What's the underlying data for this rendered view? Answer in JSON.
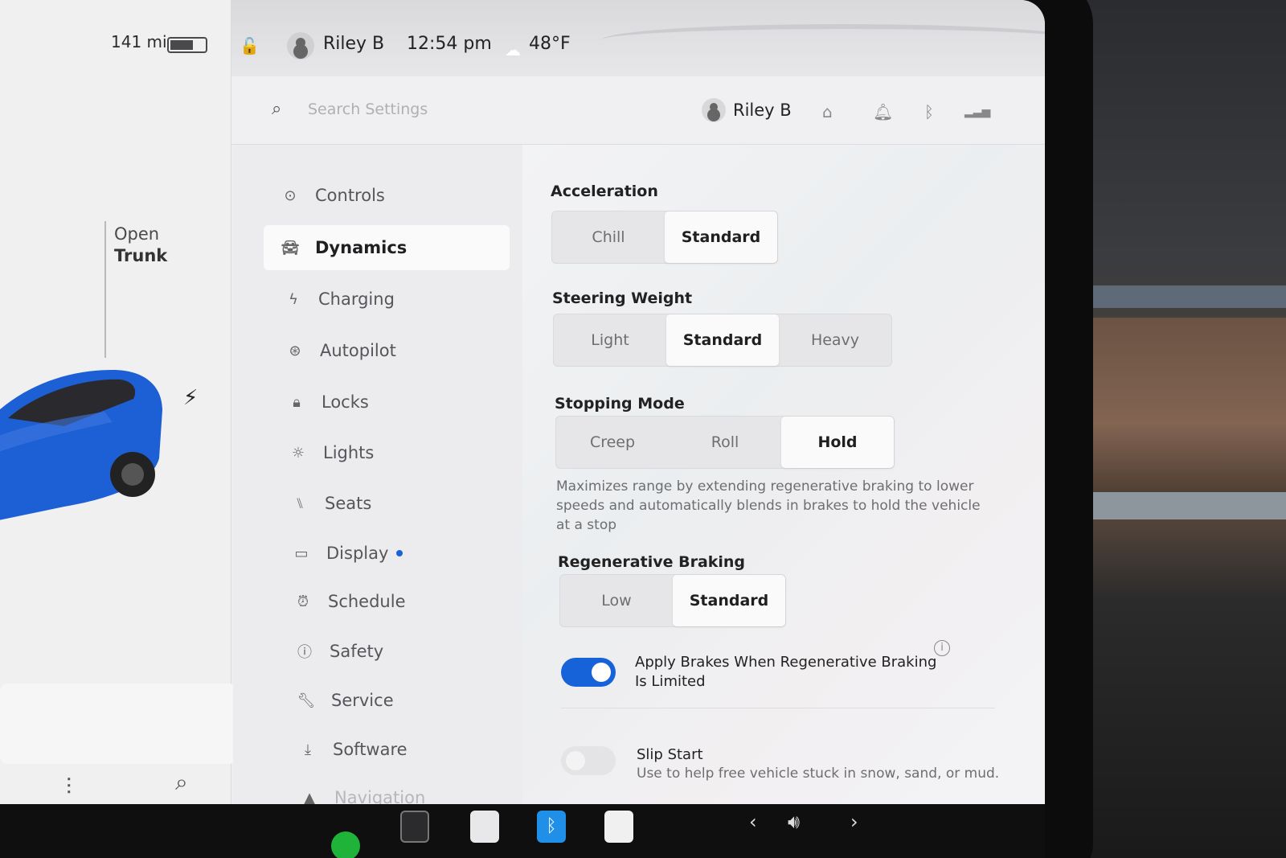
{
  "status": {
    "range": "141 mi",
    "user": "Riley B",
    "time": "12:54 pm",
    "temperature": "48°F"
  },
  "car_panel": {
    "open_label": "Open",
    "trunk_label": "Trunk"
  },
  "header": {
    "search_placeholder": "Search Settings",
    "user_name": "Riley B",
    "icons": [
      "home-icon",
      "bell-icon",
      "bluetooth-icon",
      "lte-signal-icon"
    ]
  },
  "nav": {
    "items": [
      {
        "label": "Controls",
        "icon": "toggle-icon"
      },
      {
        "label": "Dynamics",
        "icon": "car-icon",
        "active": true
      },
      {
        "label": "Charging",
        "icon": "bolt-icon"
      },
      {
        "label": "Autopilot",
        "icon": "steering-wheel-icon"
      },
      {
        "label": "Locks",
        "icon": "lock-icon"
      },
      {
        "label": "Lights",
        "icon": "sun-icon"
      },
      {
        "label": "Seats",
        "icon": "seat-icon"
      },
      {
        "label": "Display",
        "icon": "display-icon",
        "notification": true
      },
      {
        "label": "Schedule",
        "icon": "alarm-clock-icon"
      },
      {
        "label": "Safety",
        "icon": "alert-circle-icon"
      },
      {
        "label": "Service",
        "icon": "wrench-icon"
      },
      {
        "label": "Software",
        "icon": "download-icon"
      },
      {
        "label": "Navigation",
        "icon": "navigation-arrow-icon"
      }
    ]
  },
  "settings": {
    "acceleration": {
      "title": "Acceleration",
      "options": [
        "Chill",
        "Standard"
      ],
      "selected": "Standard"
    },
    "steering_weight": {
      "title": "Steering Weight",
      "options": [
        "Light",
        "Standard",
        "Heavy"
      ],
      "selected": "Standard"
    },
    "stopping_mode": {
      "title": "Stopping Mode",
      "options": [
        "Creep",
        "Roll",
        "Hold"
      ],
      "selected": "Hold",
      "description": "Maximizes range by extending regenerative braking to lower speeds and automatically blends in brakes to hold the vehicle at a stop"
    },
    "regenerative_braking": {
      "title": "Regenerative Braking",
      "options": [
        "Low",
        "Standard"
      ],
      "selected": "Standard"
    },
    "apply_brakes": {
      "label": "Apply Brakes When Regenerative Braking Is Limited",
      "enabled": true
    },
    "slip_start": {
      "title": "Slip Start",
      "description": "Use to help free vehicle stuck in snow, sand, or mud.",
      "enabled": false
    }
  },
  "colors": {
    "accent": "#1662d8",
    "car_body": "#1d5fd4"
  }
}
